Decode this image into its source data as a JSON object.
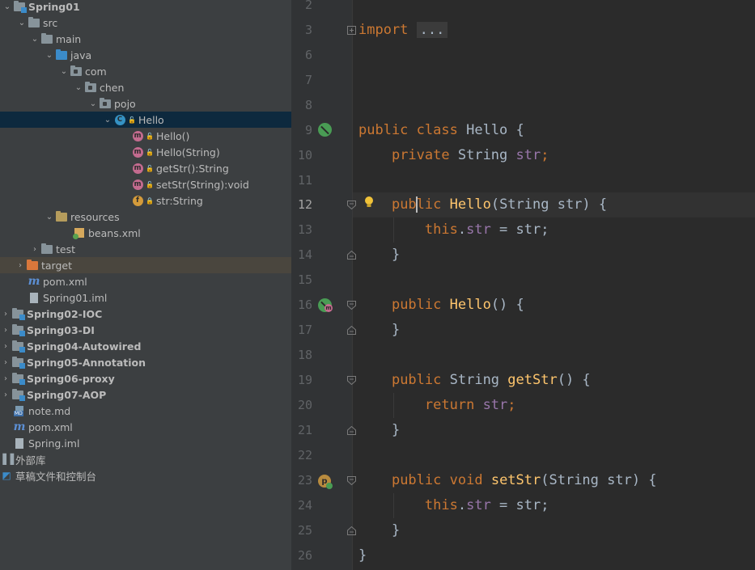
{
  "tree": {
    "items": [
      {
        "label": "Spring01",
        "bold": true
      },
      {
        "label": "src"
      },
      {
        "label": "main"
      },
      {
        "label": "java"
      },
      {
        "label": "com"
      },
      {
        "label": "chen"
      },
      {
        "label": "pojo"
      },
      {
        "label": "Hello"
      },
      {
        "label": "Hello()"
      },
      {
        "label": "Hello(String)"
      },
      {
        "label": "getStr():String"
      },
      {
        "label": "setStr(String):void"
      },
      {
        "label": "str:String"
      },
      {
        "label": "resources"
      },
      {
        "label": "beans.xml"
      },
      {
        "label": "test"
      },
      {
        "label": "target"
      },
      {
        "label": "pom.xml"
      },
      {
        "label": "Spring01.iml"
      },
      {
        "label": "Spring02-IOC",
        "bold": true
      },
      {
        "label": "Spring03-DI",
        "bold": true
      },
      {
        "label": "Spring04-Autowired",
        "bold": true
      },
      {
        "label": "Spring05-Annotation",
        "bold": true
      },
      {
        "label": "Spring06-proxy",
        "bold": true
      },
      {
        "label": "Spring07-AOP",
        "bold": true
      },
      {
        "label": "note.md"
      },
      {
        "label": "pom.xml"
      },
      {
        "label": "Spring.iml"
      },
      {
        "label": "外部库"
      },
      {
        "label": "草稿文件和控制台"
      }
    ],
    "icon_names": {
      "class_badge": "C",
      "method_badge": "m",
      "field_badge": "f",
      "maven_badge": "m",
      "md_badge": "MD"
    }
  },
  "editor": {
    "line_numbers": [
      "2",
      "3",
      "6",
      "7",
      "8",
      "9",
      "10",
      "11",
      "12",
      "13",
      "14",
      "15",
      "16",
      "17",
      "18",
      "19",
      "20",
      "21",
      "22",
      "23",
      "24",
      "25",
      "26"
    ],
    "current_line": "12",
    "code": {
      "l3_kw": "import",
      "l3_fold": "...",
      "l9_public": "public",
      "l9_class": "class",
      "l9_rest": "Hello {",
      "l10_private": "private",
      "l10_type": "String",
      "l10_field": "str",
      "l10_semi": ";",
      "l12_pub_a": "pub",
      "l12_pub_b": "lic",
      "l12_name": "Hello",
      "l12_rest": "(String str) {",
      "l13_this": "this",
      "l13_dot": ".",
      "l13_field": "str",
      "l13_rest": " = str;",
      "l14": "}",
      "l16_public": "public",
      "l16_name": "Hello",
      "l16_rest": "() {",
      "l17": "}",
      "l19_public": "public",
      "l19_type": "String",
      "l19_name": "getStr",
      "l19_rest": "() {",
      "l20_return": "return",
      "l20_field": "str",
      "l20_semi": ";",
      "l21": "}",
      "l23_public": "public",
      "l23_void": "void",
      "l23_name": "setStr",
      "l23_rest": "(String str) {",
      "l24_this": "this",
      "l24_dot": ".",
      "l24_field": "str",
      "l24_rest": " = str;",
      "l25": "}",
      "l26": "}"
    },
    "gutter_badges": {
      "method": "m",
      "property": "p"
    }
  },
  "colors": {
    "keyword": "#cc7832",
    "function": "#ffc66d",
    "field": "#9876aa",
    "text": "#a9b7c6",
    "selection": "#0d293e",
    "tree_bg": "#3c3f41",
    "editor_bg": "#2b2b2b"
  }
}
